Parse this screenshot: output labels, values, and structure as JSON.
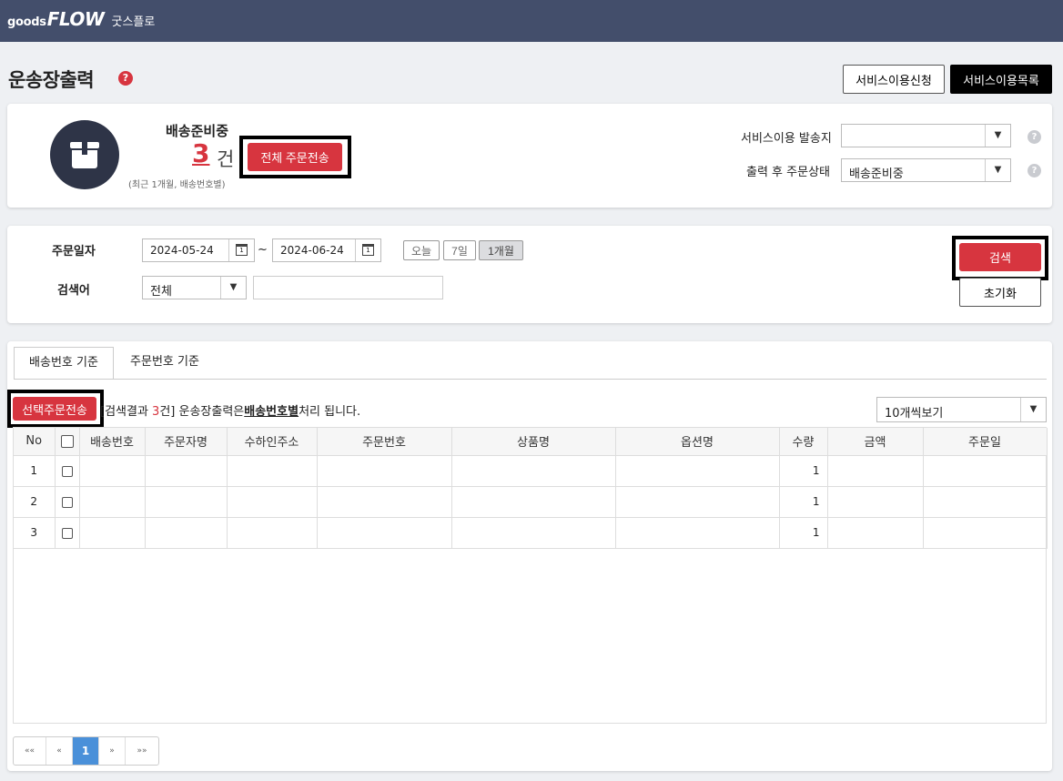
{
  "header": {
    "logo_goods": "goods",
    "logo_flow": "FLOW",
    "logo_kr": "굿스플로"
  },
  "page": {
    "title": "운송장출력",
    "help": "?",
    "btn_service_apply": "서비스이용신청",
    "btn_service_list": "서비스이용목록"
  },
  "status": {
    "title": "배송준비중",
    "count": "3",
    "unit": "건",
    "note": "(최근 1개월, 배송번호별)",
    "send_all_label": "전체 주문전송",
    "origin_label": "서비스이용 발송지",
    "origin_value": "",
    "after_label": "출력 후 주문상태",
    "after_value": "배송준비중",
    "help": "?"
  },
  "search": {
    "date_label": "주문일자",
    "date_from": "2024-05-24",
    "date_to": "2024-06-24",
    "tilde": "~",
    "range_today": "오늘",
    "range_7d": "7일",
    "range_1m": "1개월",
    "keyword_label": "검색어",
    "keyword_type": "전체",
    "keyword_value": "",
    "btn_search": "검색",
    "btn_reset": "초기화"
  },
  "tabs": [
    {
      "label": "배송번호 기준",
      "active": true
    },
    {
      "label": "주문번호 기준",
      "active": false
    }
  ],
  "results": {
    "send_selected_label": "선택주문전송",
    "prefix": "[검색결과 ",
    "count": "3",
    "mid": "건] 운송장출력은",
    "emphasis": "배송번호별",
    "suffix": "처리 됩니다.",
    "page_size": "10개씩보기"
  },
  "table": {
    "columns": [
      "No",
      "",
      "배송번호",
      "주문자명",
      "수하인주소",
      "주문번호",
      "상품명",
      "옵션명",
      "수량",
      "금액",
      "주문일"
    ],
    "rows": [
      {
        "no": "1",
        "qty": "1"
      },
      {
        "no": "2",
        "qty": "1"
      },
      {
        "no": "3",
        "qty": "1"
      }
    ]
  },
  "pager": {
    "first": "««",
    "prev": "«",
    "current": "1",
    "next": "»",
    "last": "»»"
  }
}
